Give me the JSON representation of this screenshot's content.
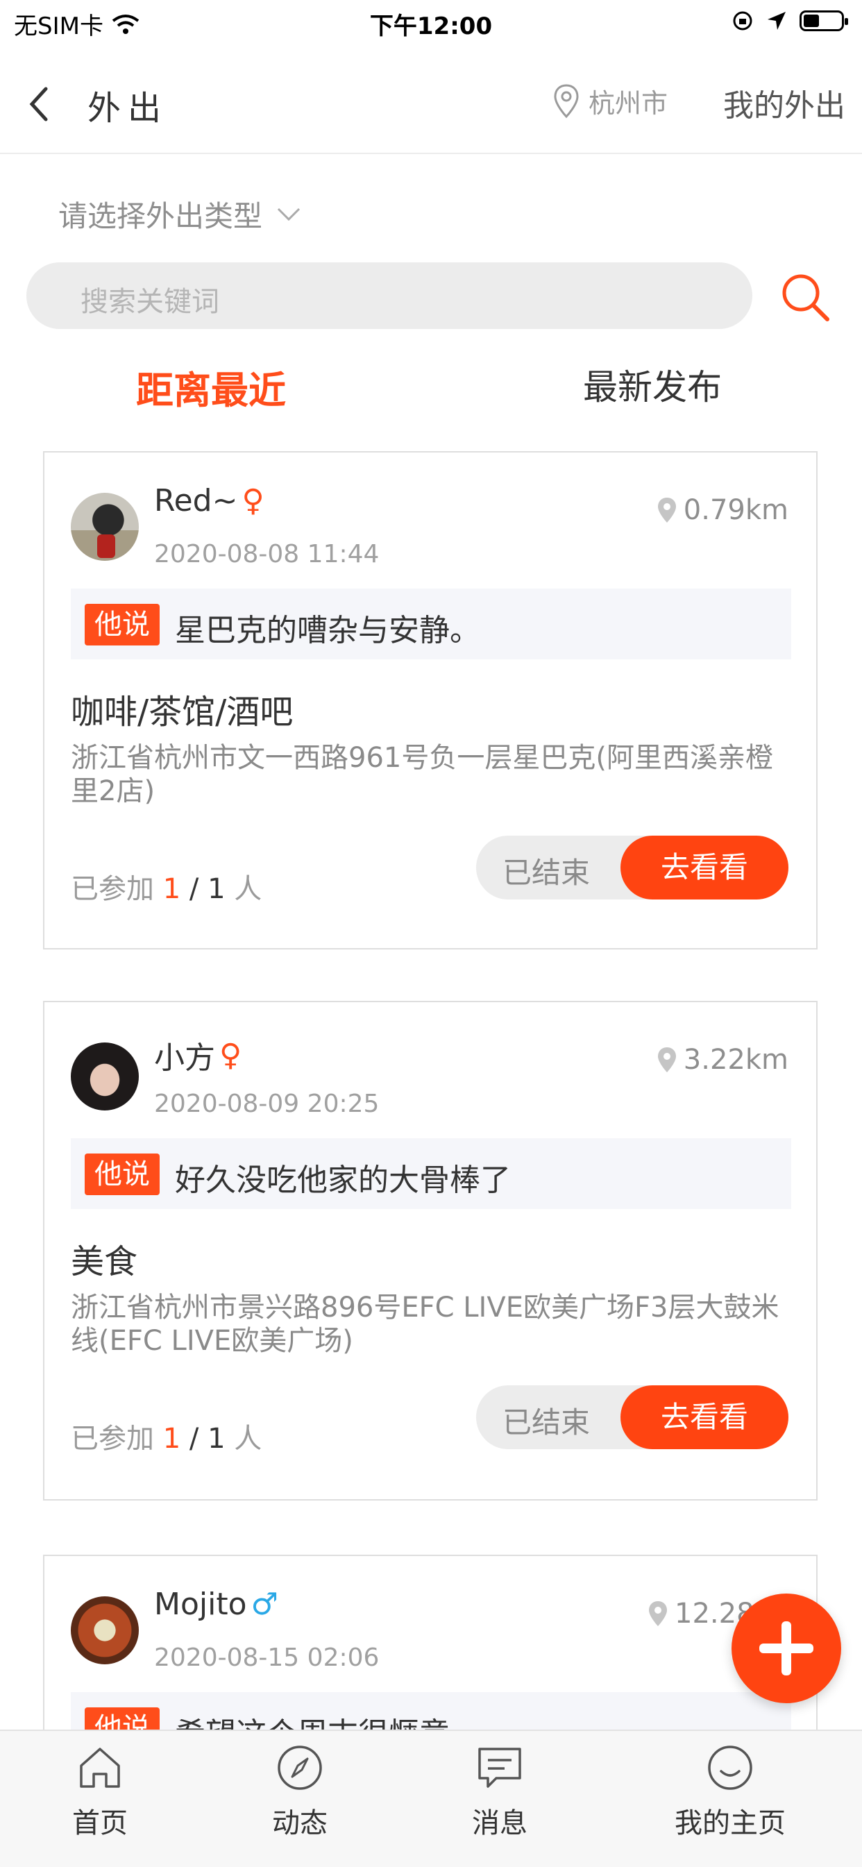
{
  "status_bar": {
    "carrier": "无SIM卡",
    "time": "下午12:00"
  },
  "nav": {
    "title": "外出",
    "city": "杭州市",
    "my_outings": "我的外出"
  },
  "filter": {
    "type_placeholder": "请选择外出类型",
    "search_placeholder": "搜索关键词"
  },
  "sort_tabs": [
    {
      "label": "距离最近",
      "active": true
    },
    {
      "label": "最新发布",
      "active": false
    }
  ],
  "said_tag": "他说",
  "ended_label": "已结束",
  "go_label": "去看看",
  "posts": [
    {
      "name": "Red~",
      "gender": "♀",
      "date": "2020-08-08 11:44",
      "distance": "0.79km",
      "said": "星巴克的嘈杂与安静。",
      "category": "咖啡/茶馆/酒吧",
      "address": "浙江省杭州市文一西路961号负一层星巴克(阿里西溪亲橙里2店)",
      "joined_prefix": "已参加",
      "joined_count": "1",
      "joined_sep": "/",
      "joined_total": "1",
      "joined_unit": "人"
    },
    {
      "name": "小方",
      "gender": "♀",
      "date": "2020-08-09 20:25",
      "distance": "3.22km",
      "said": "好久没吃他家的大骨棒了",
      "category": "美食",
      "address": "浙江省杭州市景兴路896号EFC LIVE欧美广场F3层大鼓米线(EFC LIVE欧美广场)",
      "joined_prefix": "已参加",
      "joined_count": "1",
      "joined_sep": "/",
      "joined_total": "1",
      "joined_unit": "人"
    },
    {
      "name": "Mojito",
      "gender": "♂",
      "date": "2020-08-15 02:06",
      "distance": "12.28",
      "said": "希望这个周末很惬意"
    }
  ],
  "tabbar": [
    {
      "label": "首页",
      "icon": "home-icon"
    },
    {
      "label": "动态",
      "icon": "compass-icon"
    },
    {
      "label": "消息",
      "icon": "message-icon"
    },
    {
      "label": "我的主页",
      "icon": "profile-icon"
    }
  ],
  "colors": {
    "accent": "#ff4411",
    "male": "#2aa8e6"
  }
}
